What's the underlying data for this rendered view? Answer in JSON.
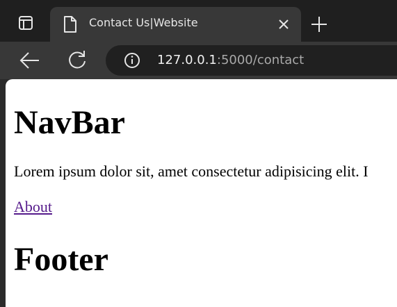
{
  "browser": {
    "tab": {
      "title": "Contact Us|Website",
      "favicon_icon": "page-icon"
    },
    "address_bar": {
      "host": "127.0.0.1",
      "path": ":5000/contact"
    }
  },
  "page": {
    "nav_heading": "NavBar",
    "intro_text": "Lorem ipsum dolor sit, amet consectetur adipisicing elit. I",
    "about_link": "About",
    "footer_heading": "Footer"
  },
  "colors": {
    "tabstrip_bg": "#1f1f1f",
    "toolbar_bg": "#383838",
    "omnibox_bg": "#202020",
    "visited_link": "#551a8b"
  }
}
